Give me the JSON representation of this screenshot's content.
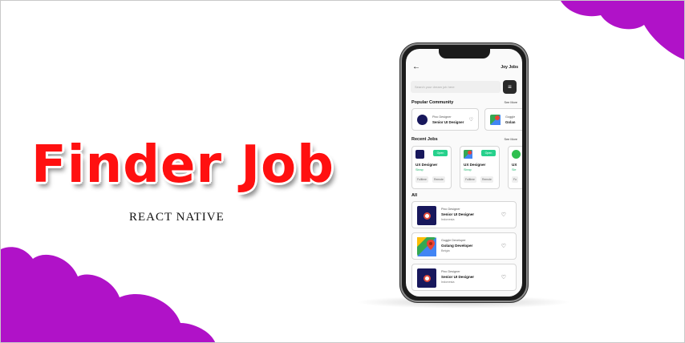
{
  "banner": {
    "headline": "Finder Job",
    "subheadline": "REACT NATIVE"
  },
  "colors": {
    "headline": "#ff1010",
    "blob": "#b012c8",
    "open_badge": "#26d18c",
    "company_text": "#22b56f",
    "icon_bg": "#18185c"
  },
  "app": {
    "logo": "Joy Jobs",
    "search": {
      "placeholder": "Search your dream job here"
    },
    "popular": {
      "heading": "Popular Community",
      "see_more": "See More",
      "items": [
        {
          "company": "Pixo Designer",
          "role": "Senior UI Designer",
          "icon": "pixo-logo-icon"
        },
        {
          "company": "Goggle",
          "role": "Golan",
          "icon": "maps-pin-icon"
        }
      ]
    },
    "recent": {
      "heading": "Recent Jobs",
      "see_more": "See More",
      "items": [
        {
          "badge": "Open",
          "title": "UX Designer",
          "company": "Sleap",
          "tags": [
            "Fulltime",
            "Remote"
          ],
          "icon": "pixo-logo-icon"
        },
        {
          "badge": "Open",
          "title": "UX Designer",
          "company": "Sleap",
          "tags": [
            "Fulltime",
            "Remote"
          ],
          "icon": "maps-pin-icon"
        },
        {
          "badge": "",
          "title": "UX",
          "company": "Sle",
          "tags": [
            "Fu"
          ],
          "icon": "green-app-icon"
        }
      ]
    },
    "all": {
      "heading": "All",
      "items": [
        {
          "company": "Pixo Designer",
          "role": "Senior UI Designer",
          "location": "Indonesia",
          "icon": "pixo-logo-icon"
        },
        {
          "company": "Goggle Developer",
          "role": "Golang Developer",
          "location": "Belgia",
          "icon": "maps-pin-icon"
        },
        {
          "company": "Pixo Designer",
          "role": "Senior UI Designer",
          "location": "Indonesia",
          "icon": "pixo-logo-icon"
        }
      ]
    }
  }
}
